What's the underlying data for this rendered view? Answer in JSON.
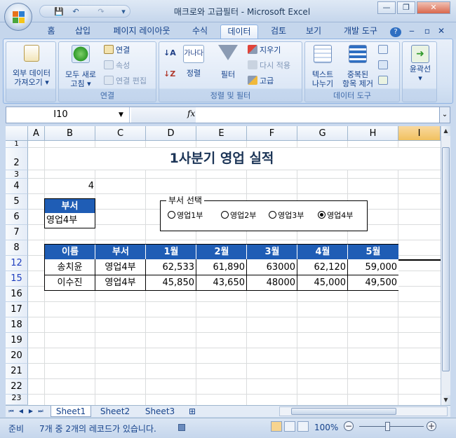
{
  "window": {
    "title": "매크로와 고급필터 - Microsoft Excel",
    "minimize": "—",
    "restore": "❐",
    "close": "✕",
    "office_button_icon": "office-logo"
  },
  "qat": {
    "save": "💾",
    "undo": "↶",
    "redo": "↷",
    "more": "▾"
  },
  "tabs": [
    {
      "label": "홈"
    },
    {
      "label": "삽입"
    },
    {
      "label": "페이지 레이아웃"
    },
    {
      "label": "수식"
    },
    {
      "label": "데이터",
      "active": true
    },
    {
      "label": "검토"
    },
    {
      "label": "보기"
    },
    {
      "label": "개발 도구"
    }
  ],
  "tabrow_icons": {
    "help": "?",
    "minimize": "‒",
    "restore": "▫",
    "close": "✕"
  },
  "ribbon": {
    "external_data": {
      "line1": "외부 데이터",
      "line2": "가져오기 ▾"
    },
    "refresh_all": {
      "line1": "모두 새로",
      "line2": "고침 ▾"
    },
    "connections": {
      "connect": "연결",
      "properties": "속성",
      "edit_links": "연결 편집",
      "group_label": "연결"
    },
    "sort_filter": {
      "sort_az": "↓A",
      "sort_za": "↓Z",
      "sort_big": "가나다",
      "sort_label": "정렬",
      "filter_label": "필터",
      "clear": "지우기",
      "reapply": "다시 적용",
      "advanced": "고급",
      "group_label": "정렬 및 필터"
    },
    "data_tools": {
      "text_to_columns": {
        "line1": "텍스트",
        "line2": "나누기"
      },
      "remove_duplicates": {
        "line1": "중복된",
        "line2": "항목 제거"
      },
      "group_label": "데이터 도구"
    },
    "outline": {
      "label": "윤곽선"
    }
  },
  "formula_bar": {
    "name_box": "I10",
    "fx": "fx",
    "formula": ""
  },
  "columns": [
    "A",
    "B",
    "C",
    "D",
    "E",
    "F",
    "G",
    "H",
    "I"
  ],
  "selected_column": "I",
  "rows": [
    "1",
    "2",
    "3",
    "4",
    "5",
    "6",
    "7",
    "8",
    "12",
    "15",
    "16",
    "17",
    "18",
    "19",
    "20",
    "21",
    "22",
    "23"
  ],
  "sheet": {
    "title": "1사분기 영업 실적",
    "b4": "4",
    "dept_header": "부서",
    "dept_value": "영업4부",
    "option_group": {
      "legend": "부서 선택",
      "options": [
        {
          "label": "영업1부",
          "checked": false
        },
        {
          "label": "영업2부",
          "checked": false
        },
        {
          "label": "영업3부",
          "checked": false
        },
        {
          "label": "영업4부",
          "checked": true
        }
      ]
    },
    "table": {
      "headers": [
        "이름",
        "부서",
        "1월",
        "2월",
        "3월",
        "4월",
        "5월"
      ],
      "rows": [
        [
          "송치윤",
          "영업4부",
          "62,533",
          "61,890",
          "63000",
          "62,120",
          "59,000"
        ],
        [
          "이수진",
          "영업4부",
          "45,850",
          "43,650",
          "48000",
          "45,000",
          "49,500"
        ]
      ]
    }
  },
  "sheet_tabs": [
    {
      "label": "Sheet1",
      "active": true
    },
    {
      "label": "Sheet2",
      "active": false
    },
    {
      "label": "Sheet3",
      "active": false
    }
  ],
  "status": {
    "ready": "준비",
    "message": "7개 중 2개의 레코드가 있습니다.",
    "zoom": "100%",
    "zoom_out": "−",
    "zoom_in": "+"
  }
}
